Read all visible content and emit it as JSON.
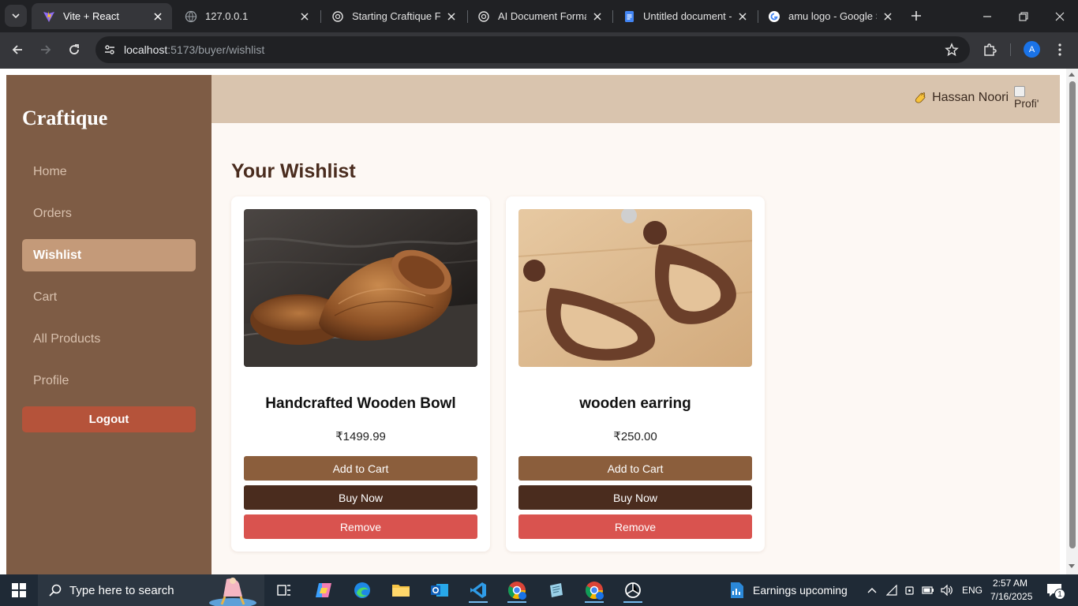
{
  "browser": {
    "tabs": [
      {
        "title": "Vite + React",
        "active": true,
        "icon": "vite-icon"
      },
      {
        "title": "127.0.0.1",
        "active": false,
        "icon": "globe-icon"
      },
      {
        "title": "Starting Craftique Fre",
        "active": false,
        "icon": "chatgpt-icon"
      },
      {
        "title": "AI Document Formatt",
        "active": false,
        "icon": "chatgpt-icon"
      },
      {
        "title": "Untitled document - ",
        "active": false,
        "icon": "google-docs-icon"
      },
      {
        "title": "amu logo - Google Se",
        "active": false,
        "icon": "google-icon"
      }
    ],
    "url_host": "localhost",
    "url_rest": ":5173/buyer/wishlist",
    "profile_initial": "A"
  },
  "app": {
    "brand": "Craftique",
    "nav": [
      {
        "label": "Home",
        "active": false
      },
      {
        "label": "Orders",
        "active": false
      },
      {
        "label": "Wishlist",
        "active": true
      },
      {
        "label": "Cart",
        "active": false
      },
      {
        "label": "All Products",
        "active": false
      },
      {
        "label": "Profile",
        "active": false
      }
    ],
    "logout_label": "Logout",
    "header": {
      "user_name": "Hassan Noori",
      "profile_alt": "Profi'"
    },
    "page_title": "Your Wishlist",
    "wishlist": [
      {
        "name": "Handcrafted Wooden Bowl",
        "price": "₹1499.99",
        "add_to_cart": "Add to Cart",
        "buy_now": "Buy Now",
        "remove": "Remove",
        "image": "wooden-bowl-photo"
      },
      {
        "name": "wooden earring",
        "price": "₹250.00",
        "add_to_cart": "Add to Cart",
        "buy_now": "Buy Now",
        "remove": "Remove",
        "image": "wooden-earring-photo"
      }
    ],
    "colors": {
      "sidebar": "#7e5c45",
      "active_nav": "#c49a79",
      "logout": "#b5533a",
      "topbar": "#d9c4ae",
      "add_to_cart": "#8b5e3c",
      "buy_now": "#4a2c1e",
      "remove": "#d9534f"
    }
  },
  "taskbar": {
    "search_placeholder": "Type here to search",
    "news": "Earnings upcoming",
    "language": "ENG",
    "time": "2:57 AM",
    "date": "7/16/2025",
    "notification_count": "1"
  }
}
